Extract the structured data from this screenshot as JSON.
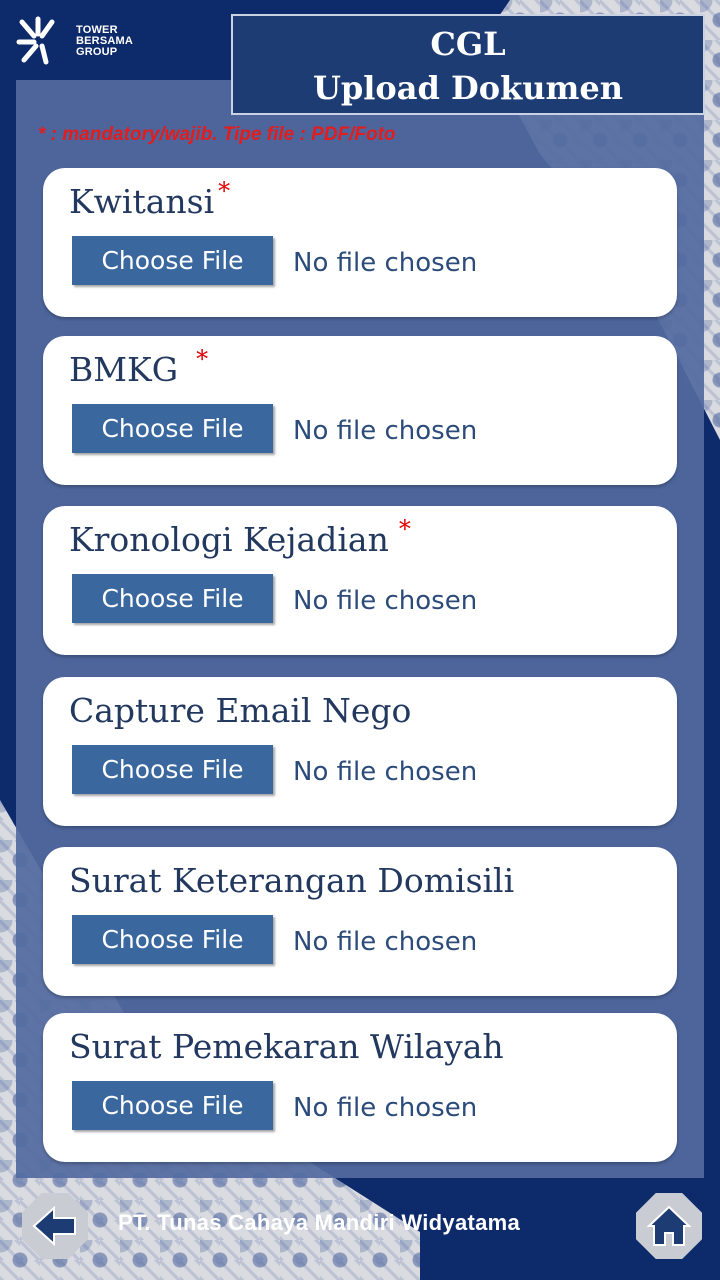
{
  "logo": {
    "lines": [
      "TOWER",
      "BERSAMA",
      "GROUP"
    ]
  },
  "header": {
    "title_line1": "CGL",
    "title_line2": "Upload Dokumen"
  },
  "note": "* : mandatory/wajib. Tipe file : PDF/Foto",
  "upload_fields": [
    {
      "label": "Kwitansi",
      "required": true,
      "button": "Choose File",
      "status": "No file chosen"
    },
    {
      "label": "BMKG",
      "required": true,
      "button": "Choose File",
      "status": "No file chosen"
    },
    {
      "label": "Kronologi Kejadian",
      "required": true,
      "button": "Choose File",
      "status": "No file chosen"
    },
    {
      "label": "Capture Email Nego",
      "required": false,
      "button": "Choose File",
      "status": "No file chosen"
    },
    {
      "label": "Surat Keterangan Domisili",
      "required": false,
      "button": "Choose File",
      "status": "No file chosen"
    },
    {
      "label": "Surat Pemekaran Wilayah",
      "required": false,
      "button": "Choose File",
      "status": "No file chosen"
    }
  ],
  "required_marker": "*",
  "footer": {
    "company": "PT. Tunas Cahaya Mandiri Widyatama"
  },
  "icons": {
    "back": "back-arrow-icon",
    "home": "home-icon"
  },
  "colors": {
    "accent": "#3a679d",
    "required": "#e00000",
    "header_bg": "#1d3c73"
  }
}
